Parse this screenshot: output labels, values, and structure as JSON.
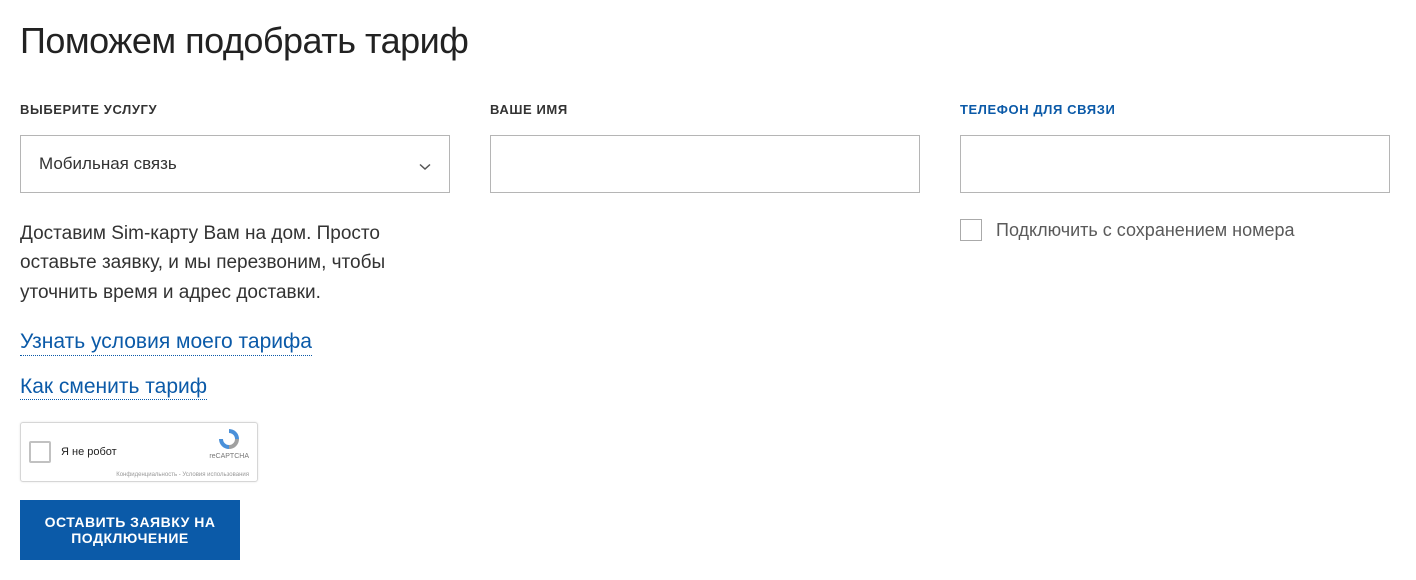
{
  "heading": "Поможем подобрать тариф",
  "service": {
    "label": "ВЫБЕРИТЕ УСЛУГУ",
    "selected": "Мобильная связь",
    "description": "Доставим Sim-карту Вам на дом. Просто оставьте заявку, и мы перезвоним, чтобы уточнить время и адрес доставки."
  },
  "name": {
    "label": "ВАШЕ ИМЯ",
    "value": ""
  },
  "phone": {
    "label": "ТЕЛЕФОН ДЛЯ СВЯЗИ",
    "value": "",
    "checkbox_label": "Подключить с сохранением номера"
  },
  "links": {
    "tariff_terms": "Узнать условия моего тарифа",
    "change_tariff": "Как сменить тариф"
  },
  "recaptcha": {
    "label": "Я не робот",
    "brand": "reCAPTCHA",
    "terms": "Конфиденциальность - Условия использования"
  },
  "submit": "ОСТАВИТЬ ЗАЯВКУ НА ПОДКЛЮЧЕНИЕ"
}
